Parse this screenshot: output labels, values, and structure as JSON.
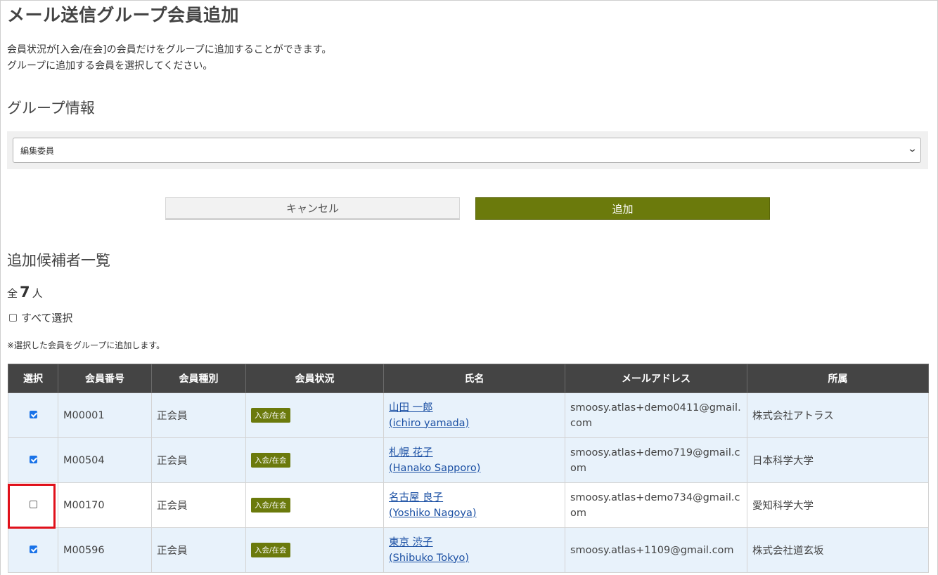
{
  "page": {
    "title": "メール送信グループ会員追加",
    "description_line1": "会員状況が[入会/在会]の会員だけをグループに追加することができます。",
    "description_line2": "グループに追加する会員を選択してください。"
  },
  "group_info": {
    "heading": "グループ情報",
    "selected_group": "編集委員"
  },
  "buttons": {
    "cancel_label": "キャンセル",
    "add_label": "追加"
  },
  "candidates": {
    "heading": "追加候補者一覧",
    "total_prefix": "全",
    "total_count": "7",
    "total_suffix": "人",
    "select_all_label": "すべて選択",
    "note": "※選択した会員をグループに追加します。"
  },
  "table": {
    "headers": [
      "選択",
      "会員番号",
      "会員種別",
      "会員状況",
      "氏名",
      "メールアドレス",
      "所属"
    ],
    "rows": [
      {
        "checked": true,
        "member_no": "M00001",
        "member_type": "正会員",
        "status": "入会/在会",
        "name_ja": "山田 一郎",
        "name_en": "(ichiro yamada)",
        "email": "smoosy.atlas+demo0411@gmail.com",
        "affiliation": "株式会社アトラス"
      },
      {
        "checked": true,
        "member_no": "M00504",
        "member_type": "正会員",
        "status": "入会/在会",
        "name_ja": "札幌 花子",
        "name_en": "(Hanako Sapporo)",
        "email": "smoosy.atlas+demo719@gmail.com",
        "affiliation": "日本科学大学"
      },
      {
        "checked": false,
        "member_no": "M00170",
        "member_type": "正会員",
        "status": "入会/在会",
        "name_ja": "名古屋 良子",
        "name_en": "(Yoshiko Nagoya)",
        "email": "smoosy.atlas+demo734@gmail.com",
        "affiliation": "愛知科学大学"
      },
      {
        "checked": true,
        "member_no": "M00596",
        "member_type": "正会員",
        "status": "入会/在会",
        "name_ja": "東京 渋子",
        "name_en": "(Shibuko Tokyo)",
        "email": "smoosy.atlas+1109@gmail.com",
        "affiliation": "株式会社道玄坂"
      }
    ]
  },
  "colors": {
    "accent": "#6b7a0c",
    "header_bg": "#444444",
    "row_shade": "#e8f2fb",
    "link": "#1a4fa3",
    "highlight": "#e0101a"
  }
}
